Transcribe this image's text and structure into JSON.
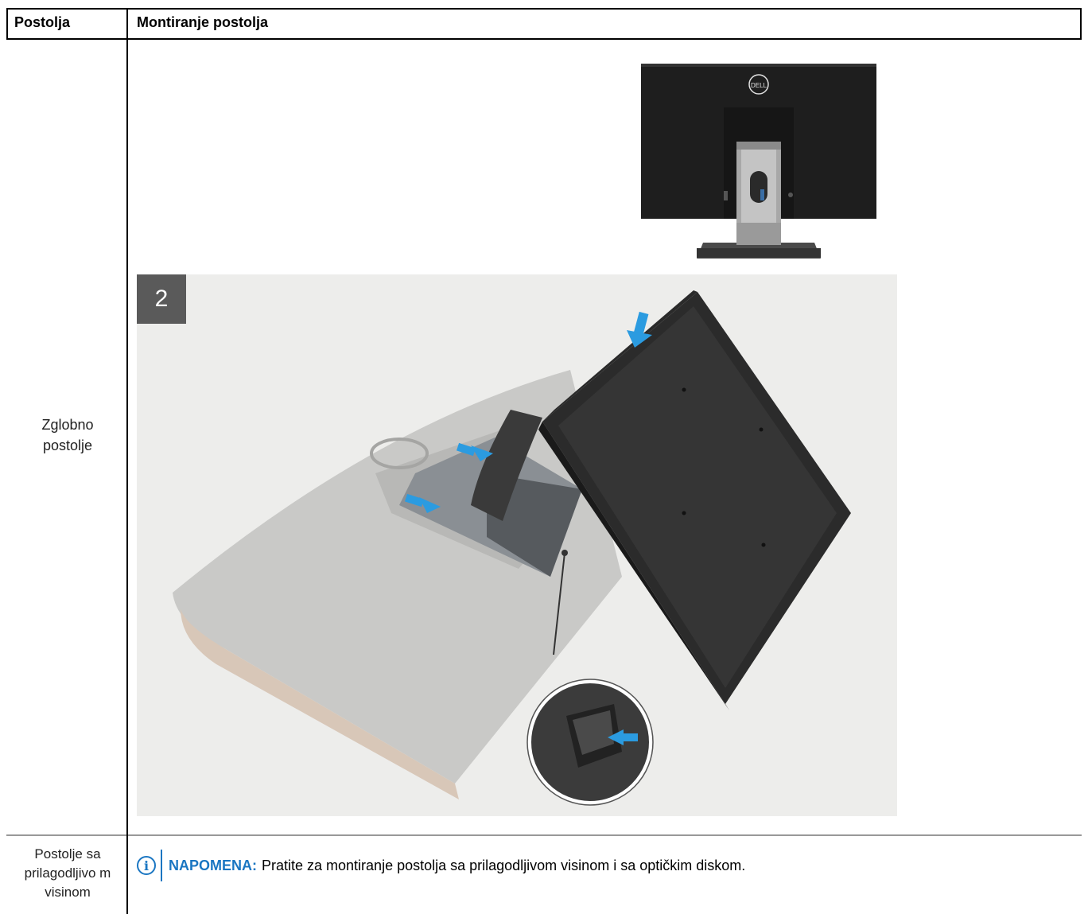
{
  "table": {
    "header": {
      "col1": "Postolja",
      "col2": "Montiranje postolja"
    },
    "rows": [
      {
        "label": "Zglobno postolje",
        "step_number": "2",
        "brand": "DELL"
      },
      {
        "label": "Postolje sa prilagodljivo m visinom",
        "note_label": "NAPOMENA:",
        "note_text": "Pratite za montiranje postolja sa prilagodljivom visinom i sa optičkim diskom."
      }
    ]
  },
  "colors": {
    "note_accent": "#1a76c2",
    "arrow_blue": "#2b9be0",
    "badge_gray": "#5a5a5a"
  }
}
